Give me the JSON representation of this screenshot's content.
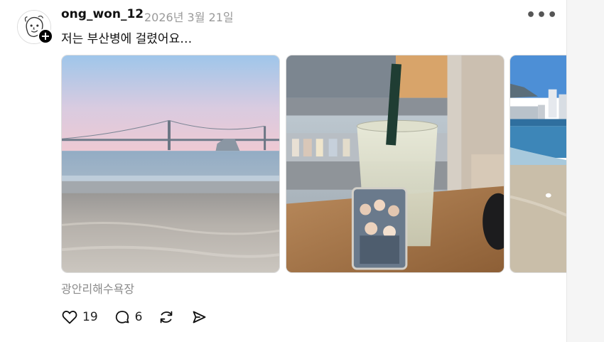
{
  "post": {
    "username": "ong_won_12",
    "date": "2026년 3월 21일",
    "text": "저는 부산병에 걸렸어요…",
    "follow_symbol": "+",
    "more_symbol": "•••",
    "location": "광안리해수욕장",
    "photos": [
      {
        "icon": "beach-bridge-photo"
      },
      {
        "icon": "iced-drink-photocard-photo"
      },
      {
        "icon": "beach-city-photo"
      }
    ],
    "actions": {
      "likes": "19",
      "comments": "6"
    }
  }
}
